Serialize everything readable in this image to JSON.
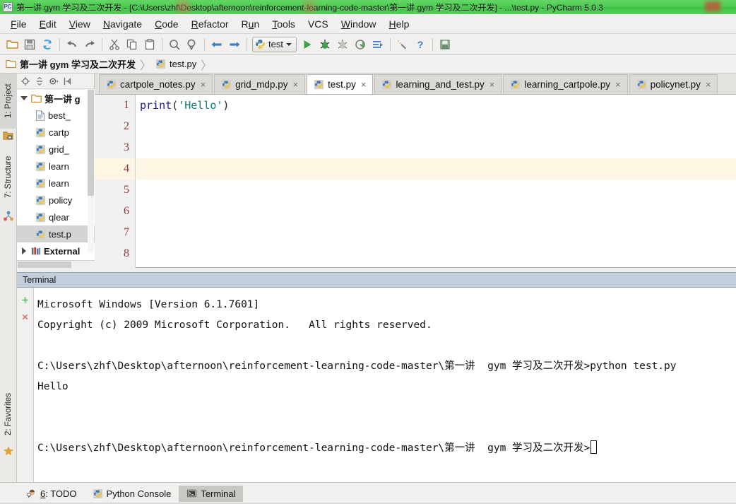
{
  "window": {
    "title": "第一讲  gym 学习及二次开发 - [C:\\Users\\zhf\\Desktop\\afternoon\\reinforcement-learning-code-master\\第一讲  gym 学习及二次开发] - ...\\test.py - PyCharm 5.0.3",
    "app_icon": "PC",
    "titlebar_color": "#4ecb52"
  },
  "menu": [
    {
      "label": "File",
      "mnemonic": "F"
    },
    {
      "label": "Edit",
      "mnemonic": "E"
    },
    {
      "label": "View",
      "mnemonic": "V"
    },
    {
      "label": "Navigate",
      "mnemonic": "N"
    },
    {
      "label": "Code",
      "mnemonic": "C"
    },
    {
      "label": "Refactor",
      "mnemonic": "R"
    },
    {
      "label": "Run",
      "mnemonic": "u"
    },
    {
      "label": "Tools",
      "mnemonic": "T"
    },
    {
      "label": "VCS",
      "mnemonic": ""
    },
    {
      "label": "Window",
      "mnemonic": "W"
    },
    {
      "label": "Help",
      "mnemonic": "H"
    }
  ],
  "toolbar": {
    "buttons": [
      "open-folder-icon",
      "save-all-icon",
      "sync-icon",
      "undo-icon",
      "redo-icon",
      "cut-icon",
      "copy-icon",
      "paste-icon",
      "find-icon",
      "replace-icon",
      "back-icon",
      "forward-icon"
    ],
    "run_config_label": "test",
    "run_buttons": [
      "run-icon",
      "debug-icon",
      "coverage-icon",
      "profile-icon",
      "run-with-icon"
    ],
    "trailing_buttons": [
      "settings-icon",
      "help-icon",
      "save-project-icon"
    ]
  },
  "breadcrumb": {
    "items": [
      {
        "label": "第一讲  gym 学习及二次开发",
        "icon": "folder-icon",
        "bold": true
      },
      {
        "label": "test.py",
        "icon": "python-file-icon",
        "bold": false
      }
    ]
  },
  "left_strip": {
    "tabs": [
      {
        "label": "1: Project",
        "mnemonic": "1",
        "icon": "project-icon",
        "selected": true
      },
      {
        "label": "7: Structure",
        "mnemonic": "7",
        "icon": "structure-icon",
        "selected": false
      }
    ],
    "bottom_tabs": [
      {
        "label": "2: Favorites",
        "mnemonic": "2",
        "icon": "star-icon",
        "selected": false
      }
    ]
  },
  "project_panel": {
    "tools": [
      "target-icon",
      "collapse-all-icon",
      "gear-icon",
      "hide-icon"
    ],
    "tree": [
      {
        "label": "第一讲  g",
        "icon": "folder-icon",
        "expanded": true,
        "level": 0,
        "selected": false
      },
      {
        "label": "best_",
        "icon": "text-file-icon",
        "level": 1,
        "selected": false
      },
      {
        "label": "cartp",
        "icon": "python-file-icon",
        "level": 1,
        "selected": false
      },
      {
        "label": "grid_",
        "icon": "python-file-icon",
        "level": 1,
        "selected": false
      },
      {
        "label": "learn",
        "icon": "python-file-icon",
        "level": 1,
        "selected": false
      },
      {
        "label": "learn",
        "icon": "python-file-icon",
        "level": 1,
        "selected": false
      },
      {
        "label": "policy",
        "icon": "python-file-icon",
        "level": 1,
        "selected": false
      },
      {
        "label": "qlear",
        "icon": "python-file-icon",
        "level": 1,
        "selected": false
      },
      {
        "label": "test.p",
        "icon": "python-file-icon",
        "level": 1,
        "selected": true
      },
      {
        "label": "External",
        "icon": "library-icon",
        "expanded": false,
        "level": 0,
        "selected": false
      }
    ]
  },
  "editor": {
    "tabs": [
      {
        "label": "cartpole_notes.py",
        "active": false
      },
      {
        "label": "grid_mdp.py",
        "active": false
      },
      {
        "label": "test.py",
        "active": true
      },
      {
        "label": "learning_and_test.py",
        "active": false
      },
      {
        "label": "learning_cartpole.py",
        "active": false
      },
      {
        "label": "policynet.py",
        "active": false
      }
    ],
    "line_numbers": [
      "1",
      "2",
      "3",
      "4",
      "5",
      "6",
      "7",
      "8"
    ],
    "current_line": 4,
    "code_lines": [
      {
        "tokens": [
          {
            "t": "print",
            "c": "kw"
          },
          {
            "t": "(",
            "c": "pn"
          },
          {
            "t": "'Hello'",
            "c": "str"
          },
          {
            "t": ")",
            "c": "pn"
          }
        ]
      },
      {
        "tokens": []
      },
      {
        "tokens": []
      },
      {
        "tokens": []
      },
      {
        "tokens": []
      },
      {
        "tokens": []
      },
      {
        "tokens": []
      },
      {
        "tokens": []
      }
    ],
    "syntax_colors": {
      "keyword": "#1a1a8c",
      "string": "#0b7a7a",
      "punct": "#222222",
      "current_line_bg": "#fdf6e3"
    }
  },
  "terminal": {
    "header_label": "Terminal",
    "gutter_buttons": [
      {
        "name": "new-session-icon",
        "glyph": "+",
        "color": "#2faa41"
      },
      {
        "name": "close-session-icon",
        "glyph": "×",
        "color": "#d9534f"
      }
    ],
    "lines": [
      "Microsoft Windows [Version 6.1.7601]",
      "Copyright (c) 2009 Microsoft Corporation.   All rights reserved.",
      "",
      "C:\\Users\\zhf\\Desktop\\afternoon\\reinforcement-learning-code-master\\第一讲  gym 学习及二次开发>python test.py",
      "Hello",
      "",
      ""
    ],
    "prompt_line": "C:\\Users\\zhf\\Desktop\\afternoon\\reinforcement-learning-code-master\\第一讲  gym 学习及二次开发>",
    "cursor": "block"
  },
  "statusbar": {
    "items": [
      {
        "label": "6: TODO",
        "mnemonic": "6",
        "icon": "todo-icon",
        "selected": false
      },
      {
        "label": "Python Console",
        "icon": "python-console-icon",
        "selected": false
      },
      {
        "label": "Terminal",
        "icon": "terminal-icon",
        "selected": true
      }
    ]
  }
}
